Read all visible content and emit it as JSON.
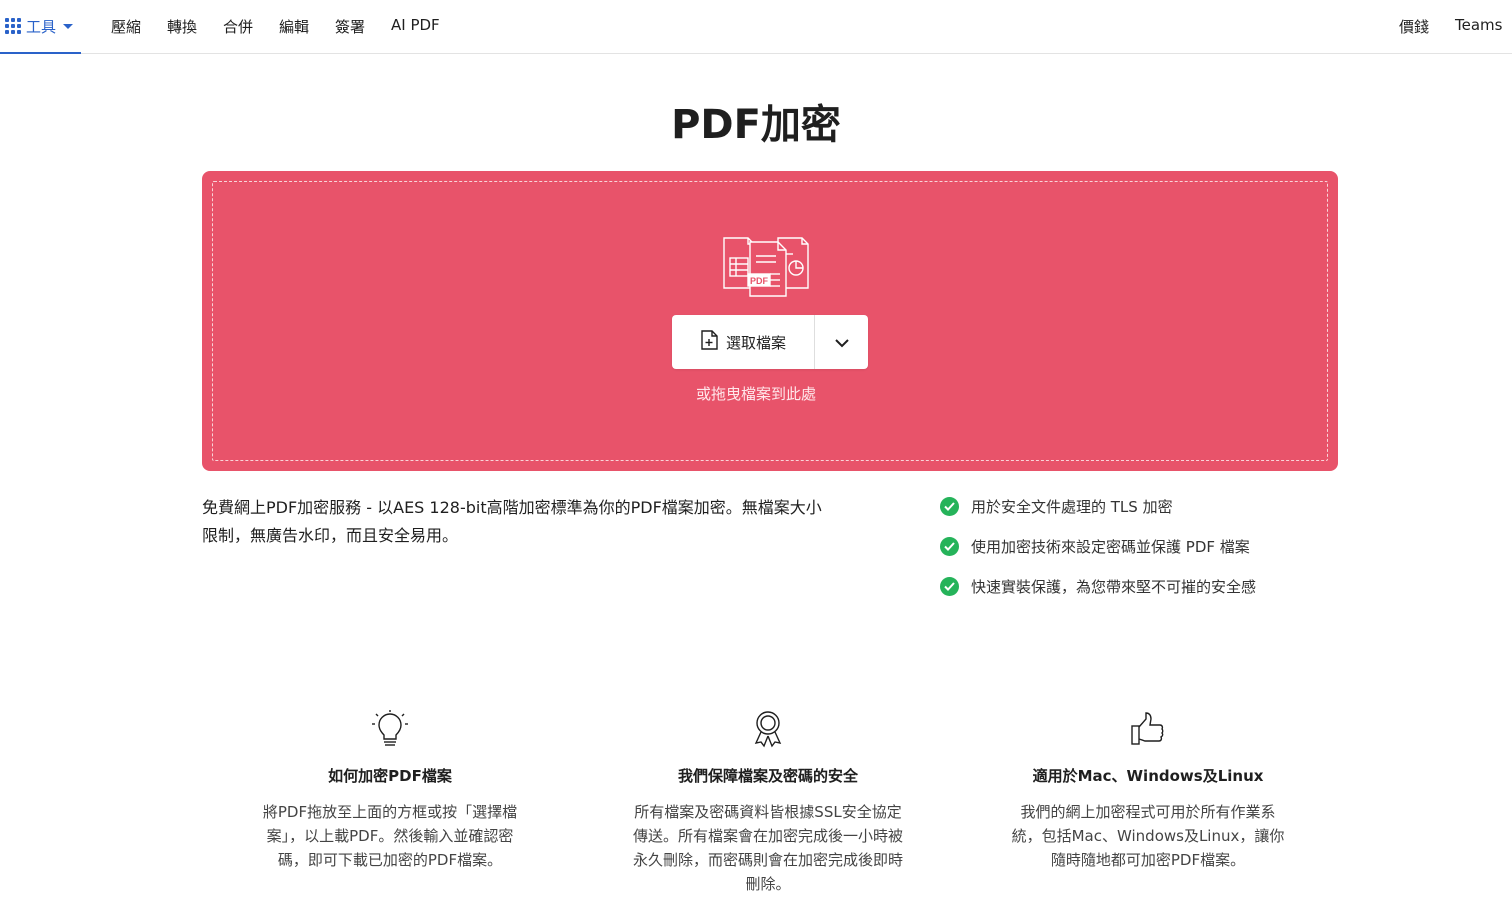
{
  "nav": {
    "tools_label": "工具",
    "links": [
      "壓縮",
      "轉換",
      "合併",
      "編輯",
      "簽署",
      "AI PDF"
    ],
    "right_links": [
      "價錢",
      "Teams"
    ]
  },
  "page": {
    "title": "PDF加密"
  },
  "dropzone": {
    "icon_badge": "PDF",
    "choose_label": "選取檔案",
    "drop_hint": "或拖曳檔案到此處",
    "bg_color": "#e8536a"
  },
  "intro": {
    "text": "免費網上PDF加密服務 - 以AES 128-bit高階加密標準為你的PDF檔案加密。無檔案大小限制，無廣告水印，而且安全易用。"
  },
  "features": [
    "用於安全文件處理的 TLS 加密",
    "使用加密技術來設定密碼並保護 PDF 檔案",
    "快速實裝保護，為您帶來堅不可摧的安全感"
  ],
  "info": [
    {
      "icon": "lightbulb-icon",
      "title": "如何加密PDF檔案",
      "body": "將PDF拖放至上面的方框或按「選擇檔案」，以上載PDF。然後輸入並確認密碼，即可下載已加密的PDF檔案。"
    },
    {
      "icon": "award-ribbon-icon",
      "title": "我們保障檔案及密碼的安全",
      "body": "所有檔案及密碼資料皆根據SSL安全協定傳送。所有檔案會在加密完成後一小時被永久刪除，而密碼則會在加密完成後即時刪除。"
    },
    {
      "icon": "thumbs-up-icon",
      "title": "適用於Mac、Windows及Linux",
      "body": "我們的網上加密程式可用於所有作業系統，包括Mac、Windows及Linux，讓你隨時隨地都可加密PDF檔案。"
    }
  ],
  "colors": {
    "accent": "#2a62c9",
    "check": "#25b35a"
  }
}
